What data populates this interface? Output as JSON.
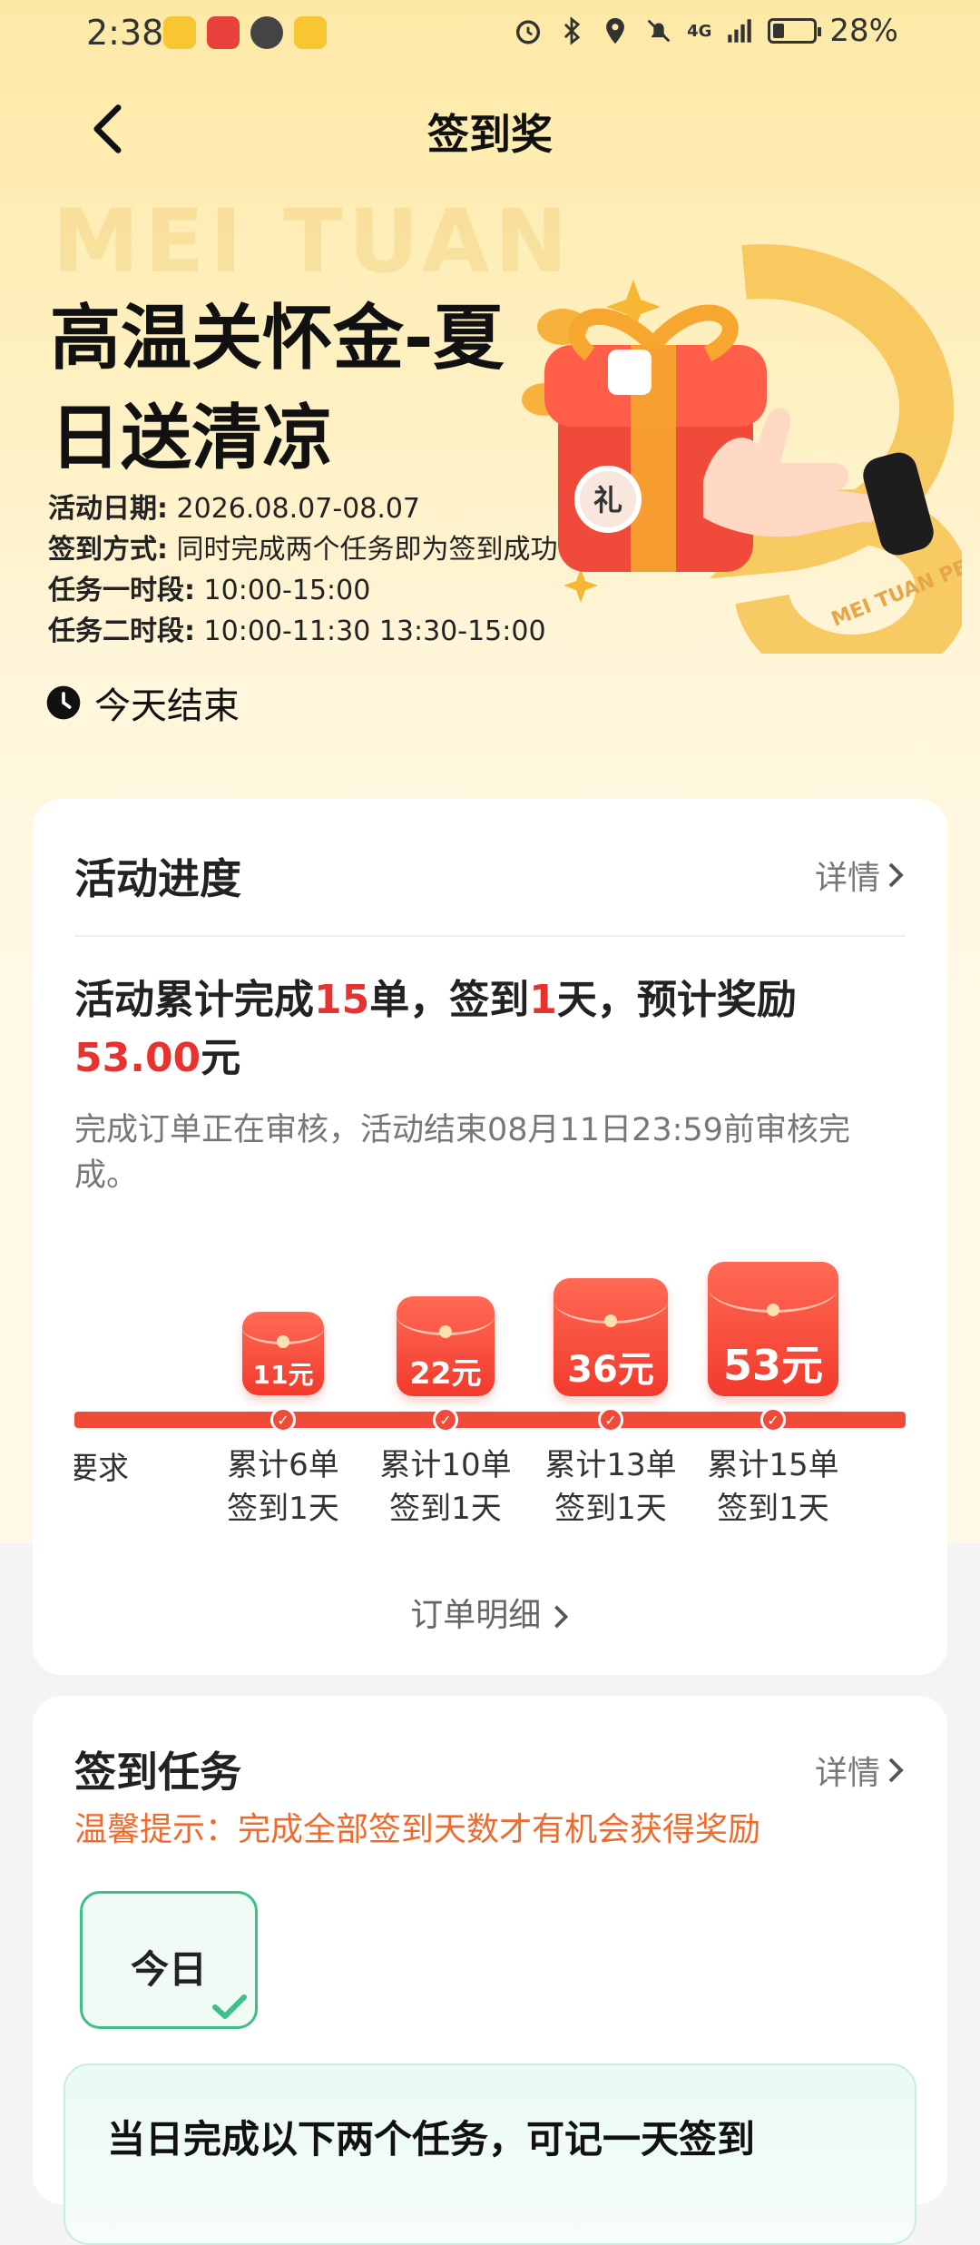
{
  "status_bar": {
    "time": "2:38",
    "network": "4G",
    "battery": "28%"
  },
  "nav": {
    "title": "签到奖"
  },
  "hero": {
    "watermark": "MEI TUAN",
    "title_line1": "高温关怀金-夏",
    "title_line2": "日送清凉",
    "info": [
      {
        "key": "活动日期:",
        "value": "2026.08.07-08.07"
      },
      {
        "key": "签到方式:",
        "value": "同时完成两个任务即为签到成功"
      },
      {
        "key": "任务一时段:",
        "value": "10:00-15:00"
      },
      {
        "key": "任务二时段:",
        "value": "10:00-11:30 13:30-15:00"
      }
    ],
    "end_text": "今天结束",
    "gift_text": "礼",
    "gift_brand": "MEI TUAN PEI SONG"
  },
  "progress_card": {
    "title": "活动进度",
    "detail_label": "详情",
    "summary_p1": "活动累计完成",
    "summary_orders": "15",
    "summary_p2": "单，签到",
    "summary_days": "1",
    "summary_p3": "天，预计奖励",
    "summary_amount": "53.00",
    "summary_unit": "元",
    "note": "完成订单正在审核，活动结束08月11日23:59前审核完成。",
    "cut_label": "要求",
    "steps": [
      {
        "amount": "11元",
        "line1": "累计6单",
        "line2": "签到1天"
      },
      {
        "amount": "22元",
        "line1": "累计10单",
        "line2": "签到1天"
      },
      {
        "amount": "36元",
        "line1": "累计13单",
        "line2": "签到1天"
      },
      {
        "amount": "53元",
        "line1": "累计15单",
        "line2": "签到1天"
      }
    ],
    "order_link": "订单明细"
  },
  "signin_card": {
    "title": "签到任务",
    "detail_label": "详情",
    "tip": "温馨提示：完成全部签到天数才有机会获得奖励",
    "day_tab": "今日",
    "task_title": "当日完成以下两个任务，可记一天签到"
  },
  "colors": {
    "accent_red": "#e8322f",
    "green": "#3fbf85",
    "tip_orange": "#f06a2c"
  }
}
